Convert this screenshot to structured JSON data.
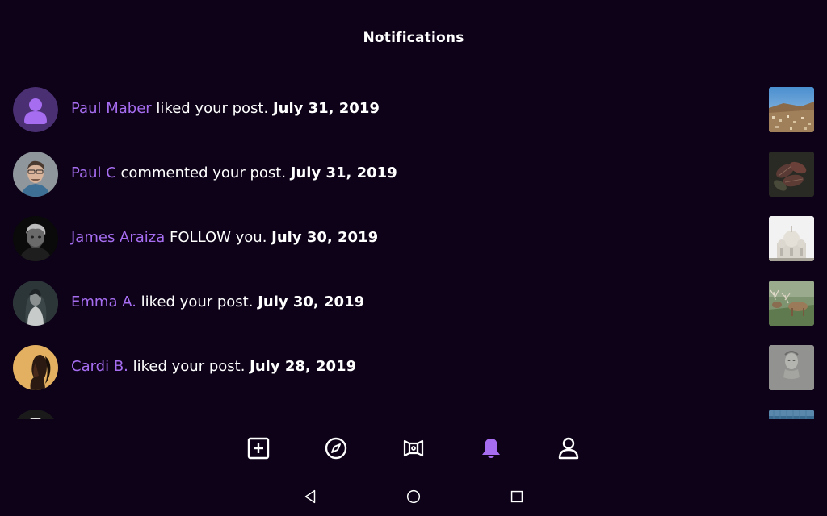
{
  "header": {
    "title": "Notifications"
  },
  "notifications": [
    {
      "name": "Paul Maber",
      "action": "liked your post.",
      "date": "July 31, 2019",
      "avatar": "default-avatar-icon",
      "thumb": "city-photo"
    },
    {
      "name": "Paul C",
      "action": "commented your post.",
      "date": "July 31, 2019",
      "avatar": "man-portrait",
      "thumb": "leaves-photo"
    },
    {
      "name": "James Araiza",
      "action": "FOLLOW you.",
      "date": "July 30, 2019",
      "avatar": "bw-man-portrait",
      "thumb": "basilica-photo"
    },
    {
      "name": "Emma A.",
      "action": "liked your post.",
      "date": "July 30, 2019",
      "avatar": "woman-portrait",
      "thumb": "deer-photo"
    },
    {
      "name": "Cardi B.",
      "action": "liked your post.",
      "date": "July 28, 2019",
      "avatar": "woman-profile-portrait",
      "thumb": "statue-photo"
    }
  ],
  "bottom_nav": [
    {
      "icon": "add-post-icon",
      "active": false
    },
    {
      "icon": "compass-icon",
      "active": false
    },
    {
      "icon": "gallery-icon",
      "active": false
    },
    {
      "icon": "bell-icon",
      "active": true
    },
    {
      "icon": "profile-icon",
      "active": false
    }
  ],
  "system_nav": [
    "back-icon",
    "home-icon",
    "recents-icon"
  ],
  "colors": {
    "background": "#0d0217",
    "accent": "#a66df1",
    "text": "#ffffff"
  }
}
